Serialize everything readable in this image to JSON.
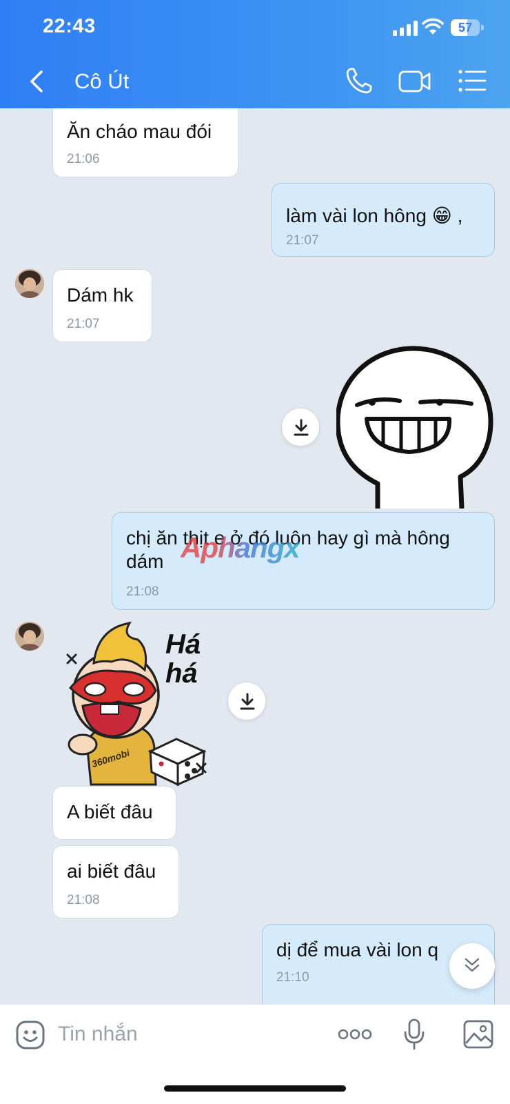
{
  "status_bar": {
    "time": "22:43",
    "battery": "57",
    "battery_level": 0.57
  },
  "header": {
    "title": "Cô Út",
    "icons": {
      "back": "back-arrow-icon",
      "call": "phone-icon",
      "video": "video-camera-icon",
      "menu": "list-menu-icon"
    }
  },
  "messages": [
    {
      "dir": "in",
      "text": "Ăn cháo mau đói",
      "time": "21:06"
    },
    {
      "dir": "out",
      "text": "làm vài lon hông 😁 ,",
      "time": "21:07"
    },
    {
      "dir": "in",
      "text": "Dám hk",
      "time": "21:07"
    },
    {
      "dir": "out",
      "type": "sticker",
      "sticker": "grinning-stickman-sticker"
    },
    {
      "dir": "out",
      "text": "chị ăn thịt e ở đó luôn hay gì mà hông dám",
      "time": "21:08"
    },
    {
      "dir": "in",
      "type": "sticker",
      "sticker": "laughing-boy-sticker",
      "sticker_text": "Há há",
      "sticker_badge": "360mobi"
    },
    {
      "dir": "in",
      "text": "A biết đâu"
    },
    {
      "dir": "in",
      "text": "ai biết đâu",
      "time": "21:08"
    },
    {
      "dir": "out",
      "text": "dị để mua vài lon q",
      "time": "21:10"
    }
  ],
  "watermark": "Aphangx",
  "composer": {
    "placeholder": "Tin nhắn",
    "icons": {
      "emoji": "emoji-icon",
      "more": "more-dots-icon",
      "mic": "microphone-icon",
      "image": "image-icon"
    }
  },
  "colors": {
    "header": "#2f7ef5",
    "outgoing_bubble": "#d5ebfb",
    "incoming_bubble": "#ffffff",
    "chat_bg": "#e2e8f0"
  }
}
